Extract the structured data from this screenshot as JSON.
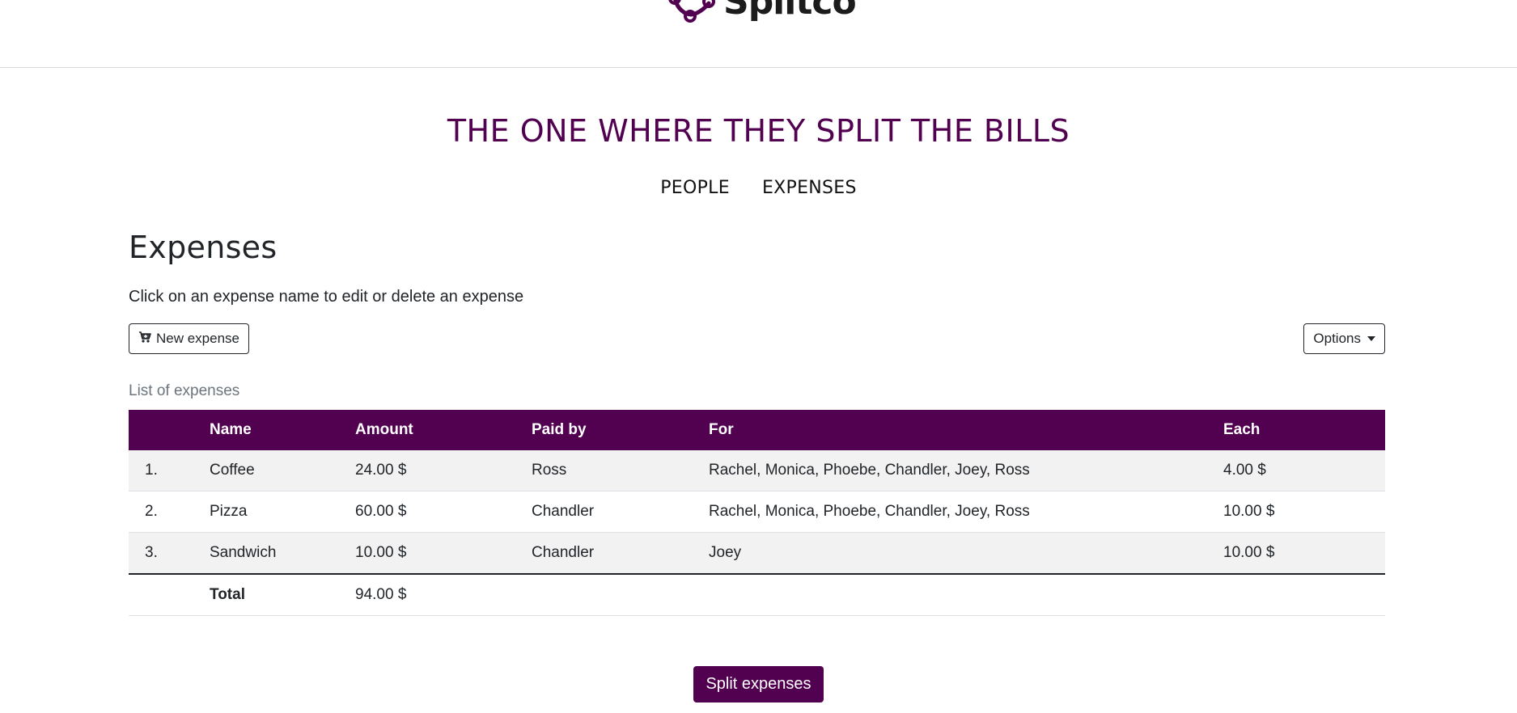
{
  "brand": {
    "logo_text": "Splitco",
    "icon": "splitco-logo-icon"
  },
  "header": {
    "title": "THE ONE WHERE THEY SPLIT THE BILLS",
    "nav": [
      {
        "label": "PEOPLE"
      },
      {
        "label": "EXPENSES"
      }
    ]
  },
  "page": {
    "heading": "Expenses",
    "hint": "Click on an expense name to edit or delete an expense",
    "new_expense_label": "New expense",
    "new_expense_icon": "cart-plus-icon",
    "options_label": "Options",
    "options_icon": "caret-down-icon"
  },
  "table": {
    "caption": "List of expenses",
    "columns": [
      "",
      "Name",
      "Amount",
      "Paid by",
      "For",
      "Each"
    ],
    "rows": [
      {
        "num": "1.",
        "name": "Coffee",
        "amount": "24.00 $",
        "paid_by": "Ross",
        "for": "Rachel, Monica, Phoebe, Chandler, Joey, Ross",
        "each": "4.00 $"
      },
      {
        "num": "2.",
        "name": "Pizza",
        "amount": "60.00 $",
        "paid_by": "Chandler",
        "for": "Rachel, Monica, Phoebe, Chandler, Joey, Ross",
        "each": "10.00 $"
      },
      {
        "num": "3.",
        "name": "Sandwich",
        "amount": "10.00 $",
        "paid_by": "Chandler",
        "for": "Joey",
        "each": "10.00 $"
      }
    ],
    "total_label": "Total",
    "total_amount": "94.00 $"
  },
  "actions": {
    "split_label": "Split expenses"
  },
  "colors": {
    "brand": "#520050",
    "row_stripe": "#f2f2f2"
  }
}
